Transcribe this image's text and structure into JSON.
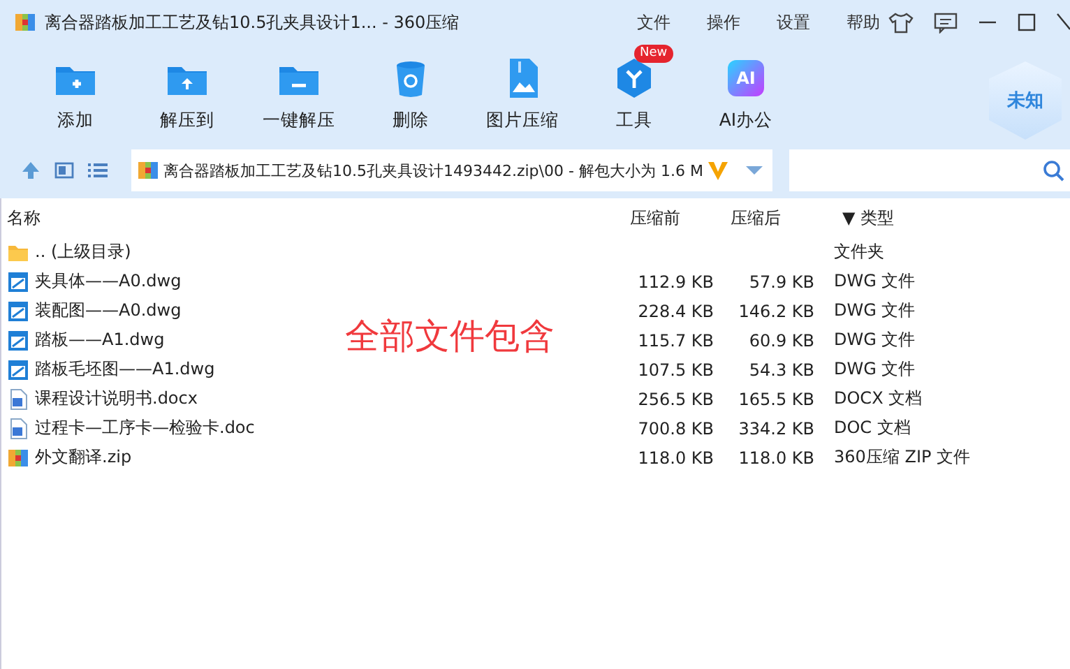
{
  "window": {
    "title": "离合器踏板加工工艺及钻10.5孔夹具设计1... - 360压缩",
    "menu": [
      "文件",
      "操作",
      "设置",
      "帮助"
    ]
  },
  "toolbar": [
    {
      "kind": "add",
      "label": "添加"
    },
    {
      "kind": "extract",
      "label": "解压到"
    },
    {
      "kind": "oneclick",
      "label": "一键解压"
    },
    {
      "kind": "delete",
      "label": "删除"
    },
    {
      "kind": "image",
      "label": "图片压缩"
    },
    {
      "kind": "tools",
      "label": "工具",
      "badge": "New"
    },
    {
      "kind": "ai",
      "label": "AI办公",
      "icon_text": "AI"
    }
  ],
  "shield": "未知",
  "address": {
    "path": "离合器踏板加工工艺及钻10.5孔夹具设计1493442.zip\\00 - 解包大小为 1.6 M"
  },
  "table": {
    "columns": [
      "名称",
      "压缩前",
      "压缩后",
      "▼ 类型"
    ],
    "rows": [
      {
        "kind": "folder",
        "name": ".. (上级目录)",
        "type": "文件夹"
      },
      {
        "kind": "dwg",
        "name": "夹具体——A0.dwg",
        "before": "112.9 KB",
        "after": "57.9 KB",
        "type": "DWG 文件"
      },
      {
        "kind": "dwg",
        "name": "装配图——A0.dwg",
        "before": "228.4 KB",
        "after": "146.2 KB",
        "type": "DWG 文件"
      },
      {
        "kind": "dwg",
        "name": "踏板——A1.dwg",
        "before": "115.7 KB",
        "after": "60.9 KB",
        "type": "DWG 文件"
      },
      {
        "kind": "dwg",
        "name": "踏板毛坯图——A1.dwg",
        "before": "107.5 KB",
        "after": "54.3 KB",
        "type": "DWG 文件"
      },
      {
        "kind": "doc",
        "name": "课程设计说明书.docx",
        "before": "256.5 KB",
        "after": "165.5 KB",
        "type": "DOCX 文档"
      },
      {
        "kind": "doc",
        "name": "过程卡—工序卡—检验卡.doc",
        "before": "700.8 KB",
        "after": "334.2 KB",
        "type": "DOC 文档"
      },
      {
        "kind": "zip",
        "name": "外文翻译.zip",
        "before": "118.0 KB",
        "after": "118.0 KB",
        "type": "360压缩 ZIP 文件"
      }
    ]
  },
  "annotation": "全部文件包含"
}
